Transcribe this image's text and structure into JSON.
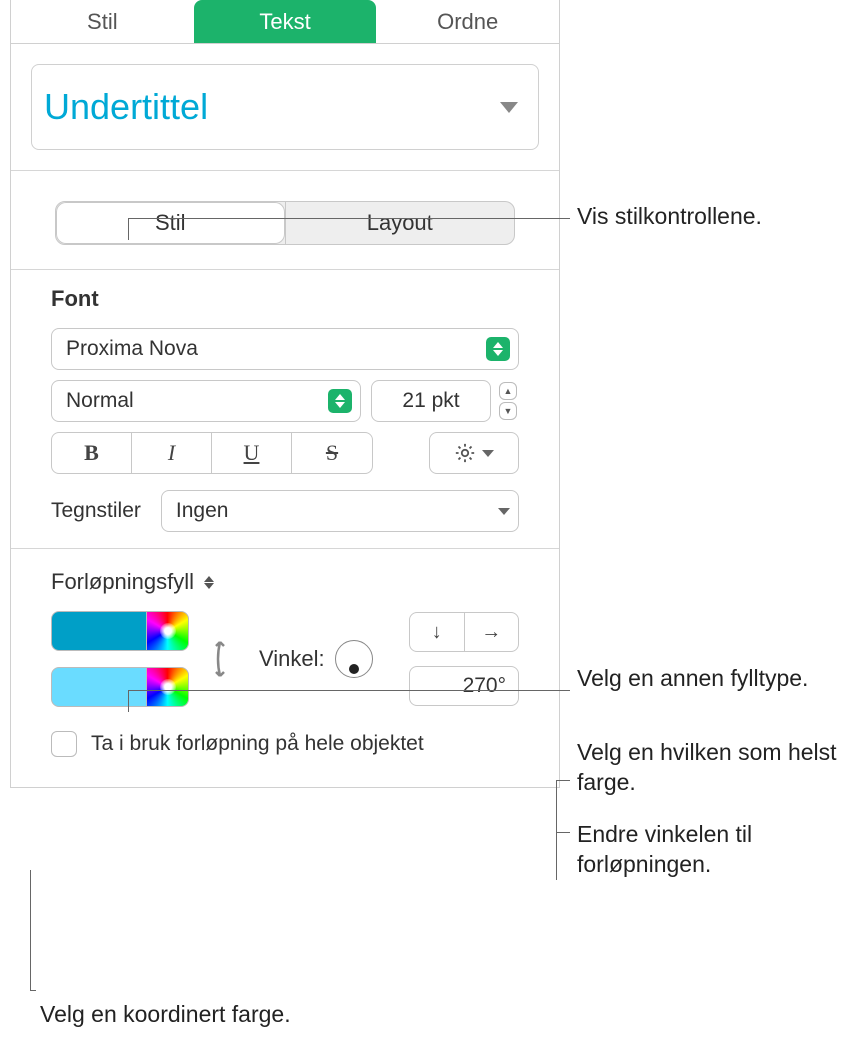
{
  "tabs": {
    "stil": "Stil",
    "tekst": "Tekst",
    "ordne": "Ordne"
  },
  "paragraph_style": "Undertittel",
  "subtabs": {
    "stil": "Stil",
    "layout": "Layout"
  },
  "font": {
    "section_title": "Font",
    "name": "Proxima Nova",
    "weight": "Normal",
    "size": "21 pkt",
    "char_styles_label": "Tegnstiler",
    "char_styles_value": "Ingen"
  },
  "bius": {
    "bold": "B",
    "italic": "I",
    "underline": "U",
    "strike": "S"
  },
  "fill": {
    "type": "Forløpningsfyll",
    "color1": "#009fc7",
    "color2": "#6adcff",
    "angle_label": "Vinkel:",
    "angle_value": "270°",
    "apply_whole_label": "Ta i bruk forløpning på hele objektet"
  },
  "callouts": {
    "show_style": "Vis stilkontrollene.",
    "fill_type": "Velg en annen fylltype.",
    "any_color": "Velg en hvilken som helst farge.",
    "angle": "Endre vinkelen til forløpningen.",
    "coord_color": "Velg en koordinert farge."
  }
}
